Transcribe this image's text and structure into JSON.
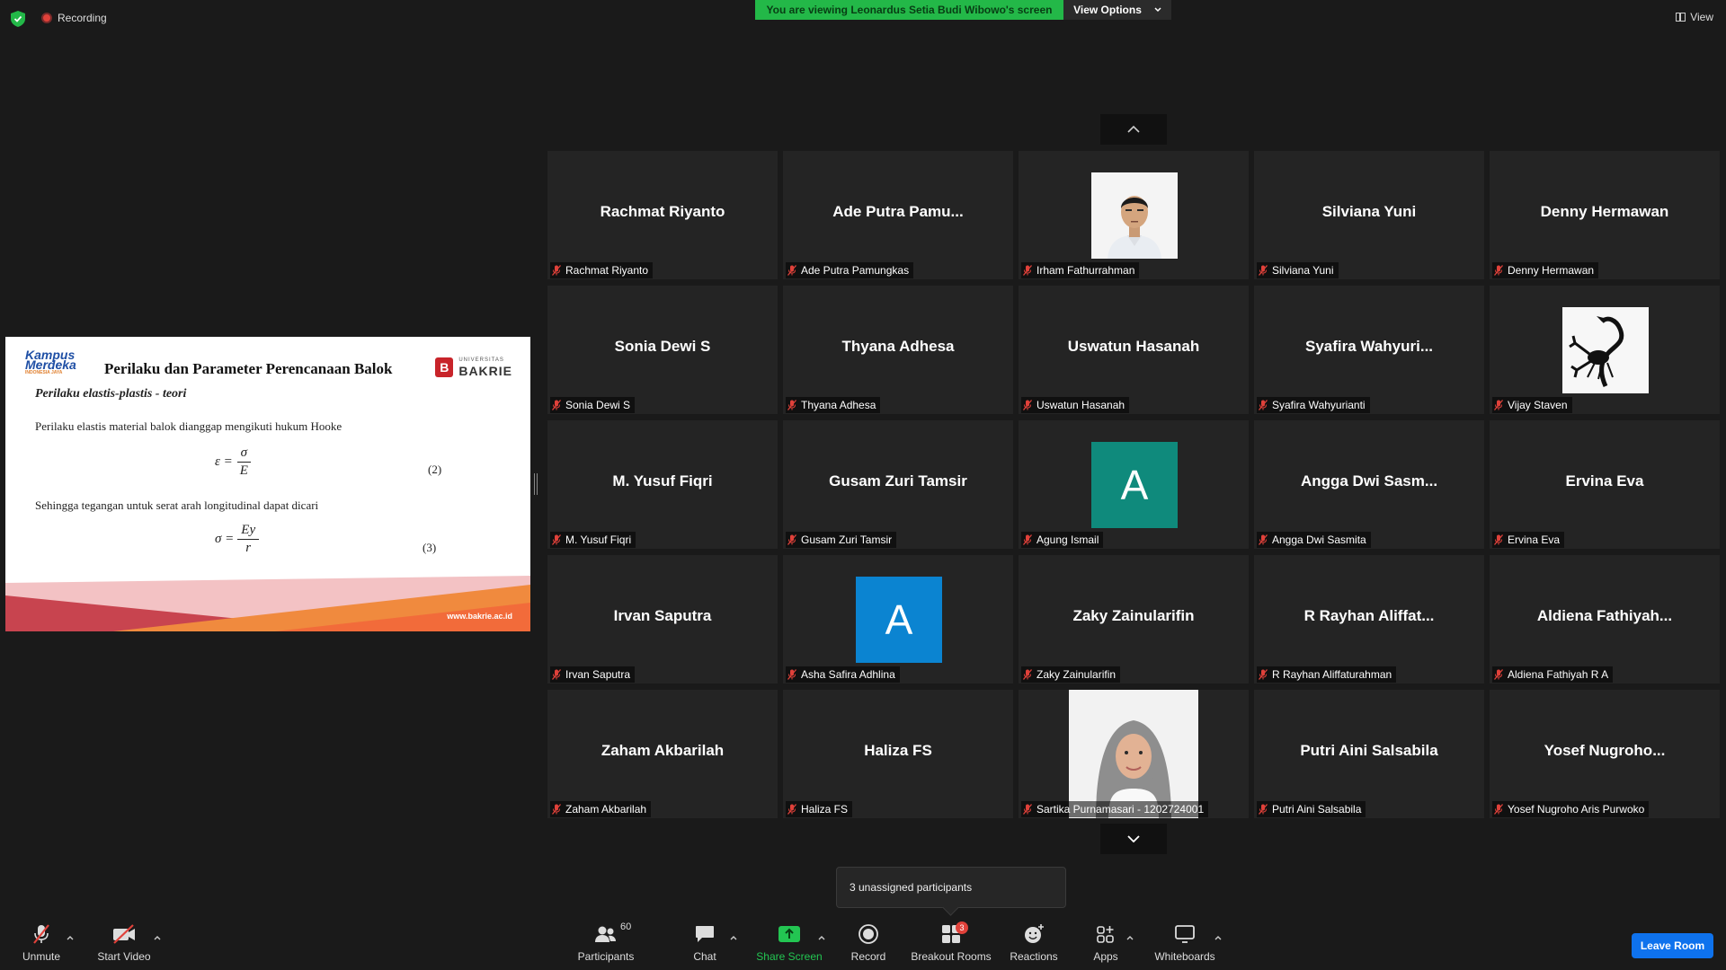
{
  "top": {
    "recording_label": "Recording",
    "banner_text": "You are viewing Leonardus Setia Budi Wibowo's screen",
    "view_options_label": "View Options",
    "view_label": "View"
  },
  "slide": {
    "logo_left_line1": "Kampus",
    "logo_left_line2": "Merdeka",
    "logo_left_sub": "INDONESIA JAYA",
    "title": "Perilaku dan Parameter Perencanaan Balok",
    "logo_right_small": "UNIVERSITAS",
    "logo_right_big": "BAKRIE",
    "logo_right_letter": "B",
    "subtitle": "Perilaku elastis-plastis - teori",
    "text1": "Perilaku elastis material balok dianggap mengikuti hukum Hooke",
    "eq1_lhs": "ε =",
    "eq1_num": "σ",
    "eq1_den": "E",
    "eq1_no": "(2)",
    "text2": "Sehingga tegangan untuk serat arah longitudinal dapat dicari",
    "eq2_lhs": "σ =",
    "eq2_num": "Ey",
    "eq2_den": "r",
    "eq2_no": "(3)",
    "url": "www.bakrie.ac.id"
  },
  "tiles": [
    {
      "name": "Rachmat Riyanto",
      "label": "Rachmat Riyanto",
      "kind": "name"
    },
    {
      "name": "Ade Putra Pamu...",
      "label": "Ade Putra Pamungkas",
      "kind": "name"
    },
    {
      "name": "",
      "label": "Irham Fathurrahman",
      "kind": "photo-man"
    },
    {
      "name": "Silviana Yuni",
      "label": "Silviana Yuni",
      "kind": "name"
    },
    {
      "name": "Denny Hermawan",
      "label": "Denny Hermawan",
      "kind": "name"
    },
    {
      "name": "Sonia Dewi S",
      "label": "Sonia Dewi S",
      "kind": "name"
    },
    {
      "name": "Thyana Adhesa",
      "label": "Thyana Adhesa",
      "kind": "name"
    },
    {
      "name": "Uswatun Hasanah",
      "label": "Uswatun Hasanah",
      "kind": "name"
    },
    {
      "name": "Syafira  Wahyuri...",
      "label": "Syafira Wahyurianti",
      "kind": "name"
    },
    {
      "name": "",
      "label": "Vijay Staven",
      "kind": "photo-scorpion"
    },
    {
      "name": "M. Yusuf Fiqri",
      "label": "M. Yusuf Fiqri",
      "kind": "name"
    },
    {
      "name": "Gusam Zuri Tamsir",
      "label": "Gusam Zuri Tamsir",
      "kind": "name"
    },
    {
      "name": "A",
      "label": "Agung Ismail",
      "kind": "avatar",
      "color": "#0f8a7c"
    },
    {
      "name": "Angga Dwi Sasm...",
      "label": "Angga Dwi Sasmita",
      "kind": "name"
    },
    {
      "name": "Ervina Eva",
      "label": "Ervina Eva",
      "kind": "name"
    },
    {
      "name": "Irvan Saputra",
      "label": "Irvan Saputra",
      "kind": "name"
    },
    {
      "name": "A",
      "label": "Asha Safira Adhlina",
      "kind": "avatar",
      "color": "#0b84d1"
    },
    {
      "name": "Zaky Zainularifin",
      "label": "Zaky Zainularifin",
      "kind": "name"
    },
    {
      "name": "R  Rayhan  Aliffat...",
      "label": "R Rayhan Aliffaturahman",
      "kind": "name"
    },
    {
      "name": "Aldiena  Fathiyah...",
      "label": "Aldiena Fathiyah R A",
      "kind": "name"
    },
    {
      "name": "Zaham Akbarilah",
      "label": "Zaham Akbarilah",
      "kind": "name"
    },
    {
      "name": "Haliza FS",
      "label": "Haliza FS",
      "kind": "name"
    },
    {
      "name": "",
      "label": "Sartika Purnamasari - 1202724001",
      "kind": "photo-woman"
    },
    {
      "name": "Putri Aini Salsabila",
      "label": "Putri Aini Salsabila",
      "kind": "name"
    },
    {
      "name": "Yosef  Nugroho...",
      "label": "Yosef Nugroho Aris Purwoko",
      "kind": "name"
    }
  ],
  "unassigned_text": "3 unassigned participants",
  "toolbar": {
    "unmute": "Unmute",
    "start_video": "Start Video",
    "participants": "Participants",
    "participants_count": "60",
    "chat": "Chat",
    "share_screen": "Share Screen",
    "record": "Record",
    "breakout_rooms": "Breakout Rooms",
    "breakout_badge": "3",
    "reactions": "Reactions",
    "apps": "Apps",
    "whiteboards": "Whiteboards",
    "leave_room": "Leave Room"
  },
  "colors": {
    "banner_green": "#23b848",
    "share_green": "#23c552",
    "leave_blue": "#0e72ed",
    "muted_red": "#e0413a"
  }
}
